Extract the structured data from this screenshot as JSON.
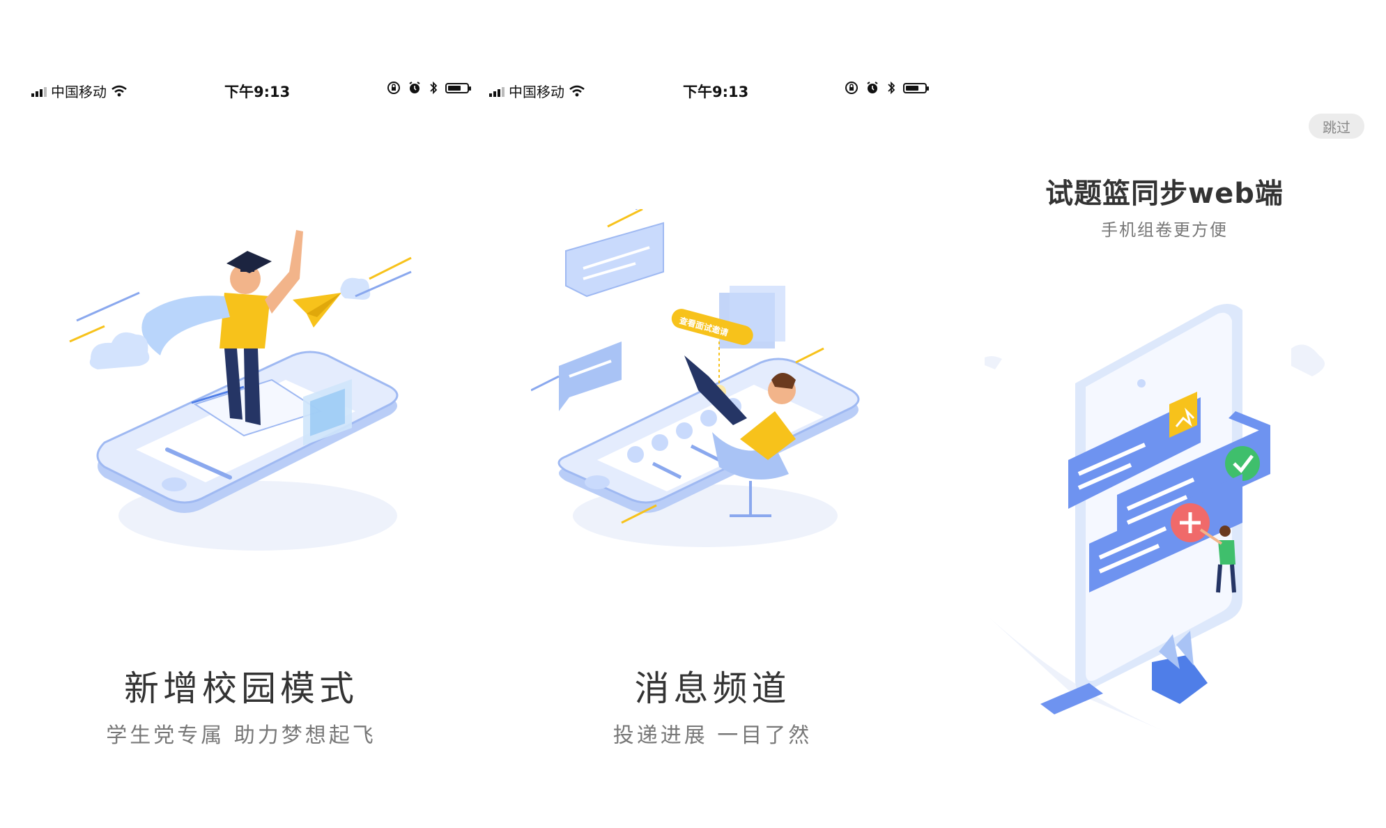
{
  "status_bar": {
    "carrier": "中国移动",
    "time": "下午9:13",
    "battery_level": 0.6
  },
  "slides": [
    {
      "title": "新增校园模式",
      "subtitle": "学生党专属  助力梦想起飞"
    },
    {
      "title": "消息频道",
      "subtitle": "投递进展  一目了然",
      "illustration_badge": "查看面试邀请"
    },
    {
      "title": "试题篮同步web端",
      "subtitle": "手机组卷更方便"
    }
  ],
  "skip_label": "跳过",
  "colors": {
    "accent_blue": "#6e93f0",
    "light_blue": "#c9dafc",
    "yellow": "#f7c21b",
    "green": "#3fbf6c",
    "red": "#f06a6a"
  },
  "icons": [
    "signal-icon",
    "wifi-icon",
    "lock-rotation-icon",
    "alarm-icon",
    "bluetooth-icon",
    "battery-icon"
  ]
}
